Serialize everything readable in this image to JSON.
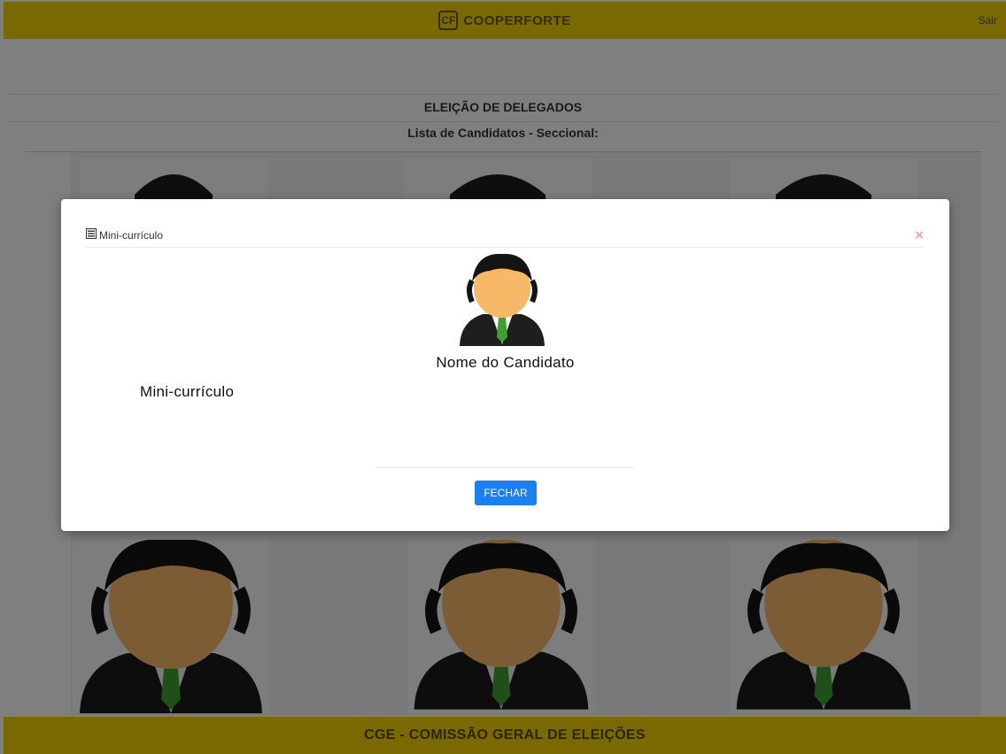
{
  "header": {
    "logo_mark": "CF",
    "brand": "COOPERFORTE",
    "logout_label": "Sair",
    "bar_color": "#f2d200"
  },
  "page": {
    "title": "ELEIÇÃO DE DELEGADOS",
    "subtitle": "Lista de Candidatos - Seccional:"
  },
  "candidates": {
    "count_visible": 6,
    "avatar_icon": "person-avatar-icon"
  },
  "footer": {
    "text": "CGE - COMISSÃO GERAL DE ELEIÇÕES"
  },
  "modal": {
    "header_icon": "document-list-icon",
    "title": "Mini-currículo",
    "close_icon": "close-icon",
    "avatar_icon": "person-avatar-icon",
    "candidate_name": "Nome do Candidato",
    "curriculum": "Mini-currículo",
    "close_button_label": "FECHAR",
    "button_color": "#1a7ff0"
  }
}
